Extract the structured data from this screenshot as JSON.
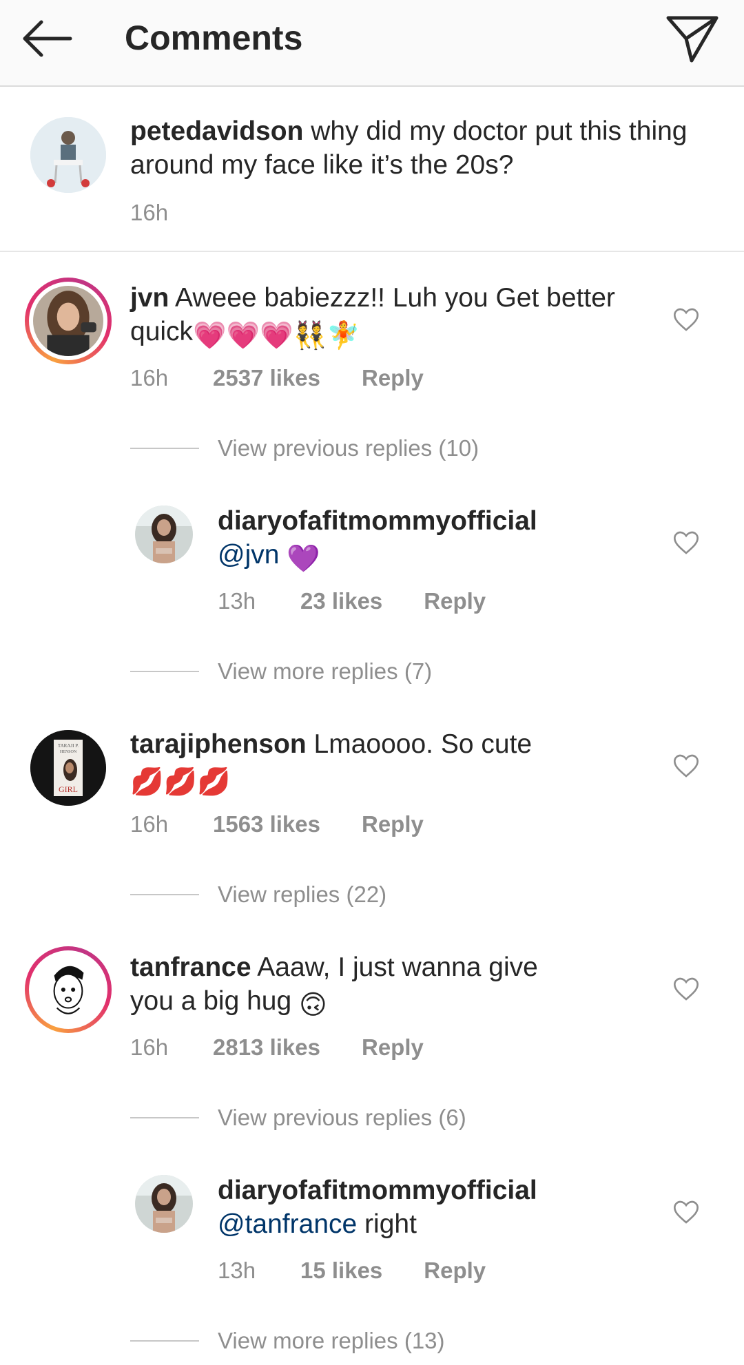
{
  "header": {
    "title": "Comments",
    "back_icon": "arrow-left-icon",
    "send_icon": "paper-plane-icon"
  },
  "caption": {
    "username": "petedavidson",
    "text": " why did my doctor put this thing around my face like it’s the 20s?",
    "time": "16h"
  },
  "comments": [
    {
      "username": "jvn",
      "text": " Aweee babiezzz!! Luh you Get better quick",
      "emojis": "💗💗💗👯🧚",
      "time": "16h",
      "likes": "2537 likes",
      "reply": "Reply",
      "view_replies": "View previous replies (10)"
    },
    {
      "username": "diaryofafitmommyofficial",
      "mention": "@jvn",
      "text": "",
      "emojis": "💜",
      "time": "13h",
      "likes": "23 likes",
      "reply": "Reply",
      "view_replies": "View more replies (7)"
    },
    {
      "username": "tarajiphenson",
      "text": " Lmaoooo. So cute",
      "emojis": "💋💋💋",
      "time": "16h",
      "likes": "1563 likes",
      "reply": "Reply",
      "view_replies": "View replies (22)"
    },
    {
      "username": "tanfrance",
      "text": " Aaaw, I just wanna give you a big hug",
      "emojis": "🙃",
      "time": "16h",
      "likes": "2813 likes",
      "reply": "Reply",
      "view_replies": "View previous replies (6)"
    },
    {
      "username": "diaryofafitmommyofficial",
      "mention": "@tanfrance",
      "text": " right",
      "emojis": "",
      "time": "13h",
      "likes": "15 likes",
      "reply": "Reply",
      "view_replies": "View more replies (13)"
    }
  ],
  "avatar_texts": {
    "taraji_top": "TARAJI P.",
    "taraji_mid": "HENSON",
    "taraji_bottom": "GIRL"
  },
  "colors": {
    "mention": "#003569",
    "meta": "#8e8e8e",
    "ring_start": "#f9a03f",
    "ring_end": "#c13584"
  }
}
